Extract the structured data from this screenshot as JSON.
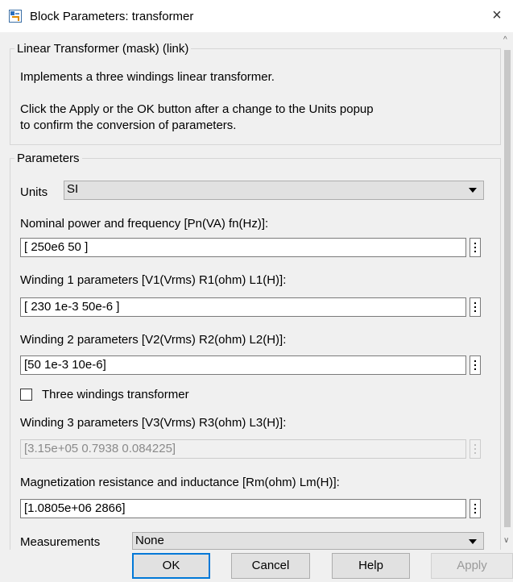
{
  "window": {
    "title": "Block Parameters: transformer",
    "close_glyph": "×"
  },
  "mask": {
    "legend": "Linear Transformer (mask) (link)",
    "description": "Implements a three windings linear transformer.",
    "note_line1": "Click the Apply or the OK button after a change to the Units popup",
    "note_line2": "to confirm the conversion of parameters."
  },
  "parameters": {
    "legend": "Parameters",
    "units": {
      "label": "Units",
      "value": "SI"
    },
    "nominal": {
      "label": "Nominal power and frequency [Pn(VA) fn(Hz)]:",
      "value": "[ 250e6 50 ]"
    },
    "winding1": {
      "label": "Winding 1 parameters [V1(Vrms) R1(ohm) L1(H)]:",
      "value": "[ 230 1e-3 50e-6 ]"
    },
    "winding2": {
      "label": "Winding 2 parameters [V2(Vrms) R2(ohm) L2(H)]:",
      "value": "[50 1e-3 10e-6]"
    },
    "three_windings": {
      "label": "Three windings transformer",
      "checked": false
    },
    "winding3": {
      "label": "Winding 3 parameters [V3(Vrms) R3(ohm) L3(H)]:",
      "value": "[3.15e+05 0.7938 0.084225]",
      "enabled": false
    },
    "magnetization": {
      "label": "Magnetization resistance and inductance [Rm(ohm) Lm(H)]:",
      "value": "[1.0805e+06 2866]"
    },
    "measurements": {
      "label": "Measurements",
      "value": "None"
    }
  },
  "buttons": {
    "ok": "OK",
    "cancel": "Cancel",
    "help": "Help",
    "apply": "Apply"
  },
  "colors": {
    "focus_border": "#0078d7",
    "panel_bg": "#f0f0f0"
  },
  "icons": {
    "app": "simulink-block-icon",
    "close": "close-icon",
    "more": "ellipsis-icon",
    "dropdown": "chevron-down-icon"
  }
}
